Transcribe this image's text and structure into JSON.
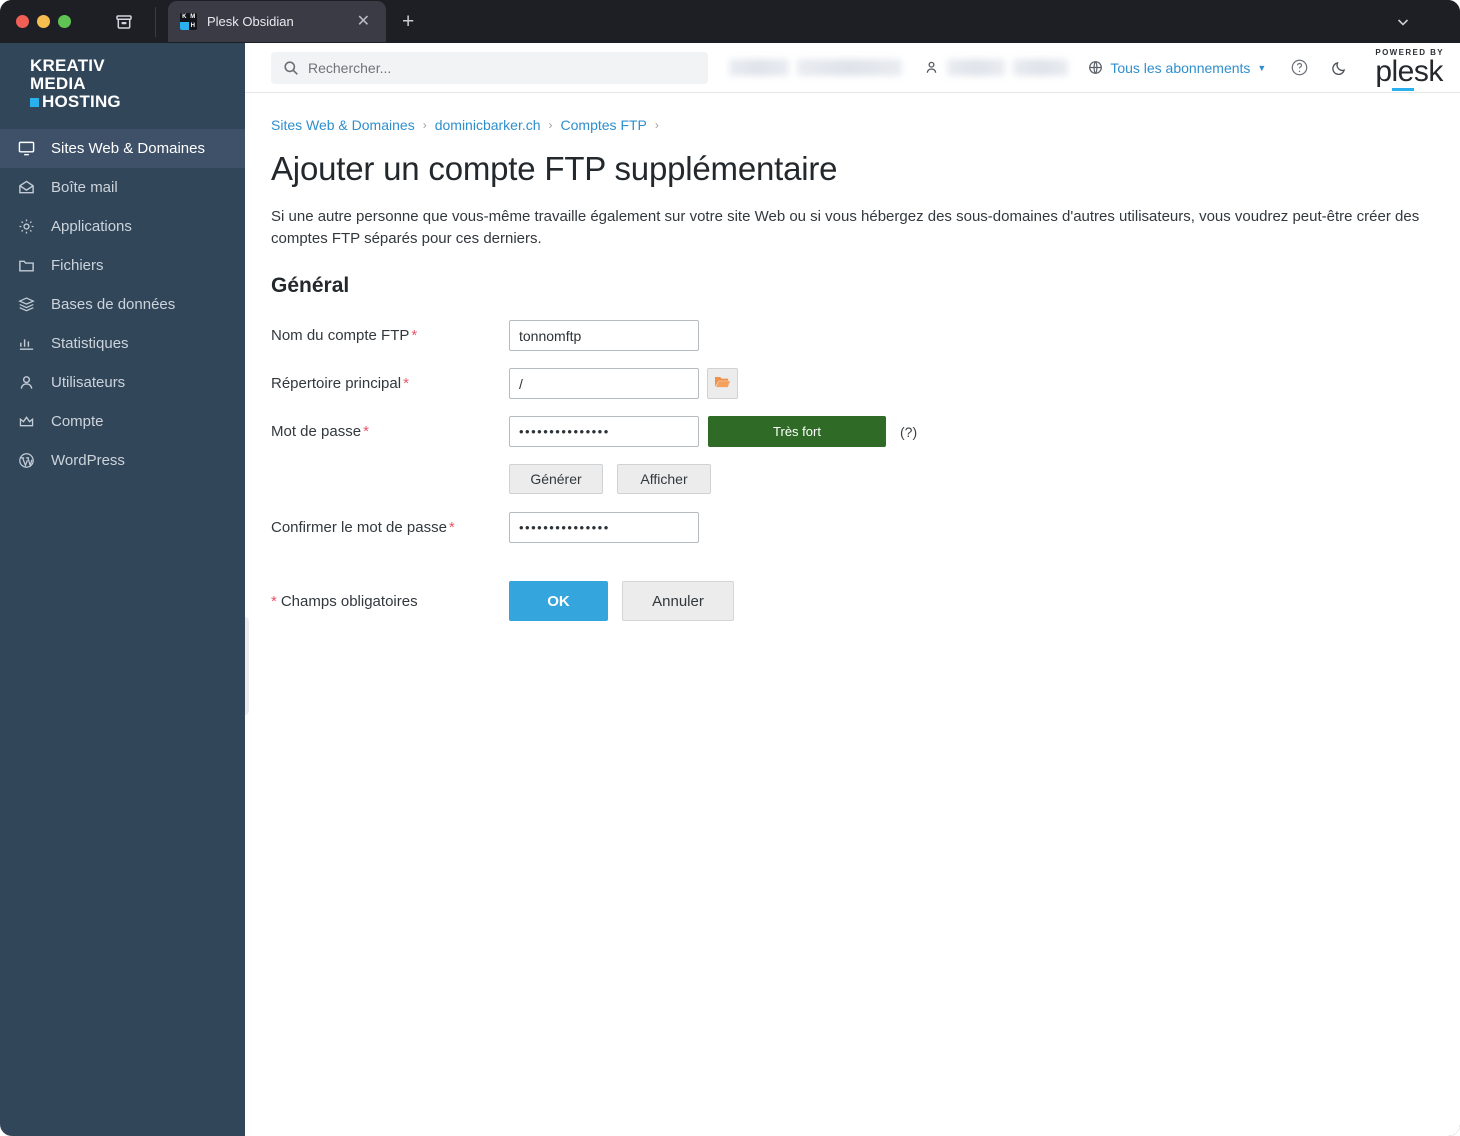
{
  "browser": {
    "tab_title": "Plesk Obsidian",
    "favicon_letters": [
      "K",
      "M",
      "",
      "H"
    ],
    "close_icon": "close-icon",
    "new_tab_icon": "plus-icon",
    "archive_icon": "tab-archive-icon",
    "overflow_icon": "chevron-down-icon"
  },
  "sidebar": {
    "brand": {
      "line1": "KREATIV",
      "line2": "MEDIA",
      "line3": "HOSTING"
    },
    "items": [
      {
        "label": "Sites Web & Domaines",
        "icon": "monitor-icon",
        "active": true
      },
      {
        "label": "Boîte mail",
        "icon": "envelope-icon",
        "active": false
      },
      {
        "label": "Applications",
        "icon": "gear-icon",
        "active": false
      },
      {
        "label": "Fichiers",
        "icon": "folder-icon",
        "active": false
      },
      {
        "label": "Bases de données",
        "icon": "database-stack-icon",
        "active": false
      },
      {
        "label": "Statistiques",
        "icon": "bar-chart-icon",
        "active": false
      },
      {
        "label": "Utilisateurs",
        "icon": "user-icon",
        "active": false
      },
      {
        "label": "Compte",
        "icon": "crown-icon",
        "active": false
      },
      {
        "label": "WordPress",
        "icon": "wordpress-icon",
        "active": false
      }
    ]
  },
  "topbar": {
    "search_placeholder": "Rechercher...",
    "search_value": "",
    "search_icon": "search-icon",
    "user_icon": "person-icon",
    "subscriptions_label": "Tous les abonnements",
    "subscriptions_icon": "globe-icon",
    "subscriptions_caret": "chevron-down-icon",
    "help_icon": "question-circle-icon",
    "theme_icon": "moon-icon",
    "logo": {
      "powered_by": "POWERED BY",
      "name_pre": "p",
      "name_mid": "le",
      "name_post": "sk"
    }
  },
  "breadcrumb": [
    {
      "label": "Sites Web & Domaines",
      "link": true
    },
    {
      "label": "dominicbarker.ch",
      "link": true
    },
    {
      "label": "Comptes FTP",
      "link": true
    }
  ],
  "page": {
    "title": "Ajouter un compte FTP supplémentaire",
    "intro": "Si une autre personne que vous-même travaille également sur votre site Web ou si vous hébergez des sous-domaines d'autres utilisateurs, vous voudrez peut-être créer des comptes FTP séparés pour ces derniers.",
    "section_title": "Général",
    "required_marker": "*",
    "mandatory_note": "Champs obligatoires"
  },
  "form": {
    "ftp_name": {
      "label": "Nom du compte FTP",
      "value": "tonnomftp",
      "required": true
    },
    "home_directory": {
      "label": "Répertoire principal",
      "value": "/",
      "required": true,
      "browse_icon": "folder-open-icon"
    },
    "password": {
      "label": "Mot de passe",
      "value": "•••••••••••••••",
      "required": true,
      "strength_label": "Très fort",
      "strength_color": "#2f6b27",
      "help_label": "(?)",
      "generate_label": "Générer",
      "show_label": "Afficher"
    },
    "confirm_password": {
      "label": "Confirmer le mot de passe",
      "value": "•••••••••••••••",
      "required": true
    }
  },
  "actions": {
    "ok_label": "OK",
    "cancel_label": "Annuler",
    "ok_color": "#35a5dd"
  },
  "collapse_handle": {
    "icon": "chevron-left-icon",
    "glyph": "‹"
  }
}
